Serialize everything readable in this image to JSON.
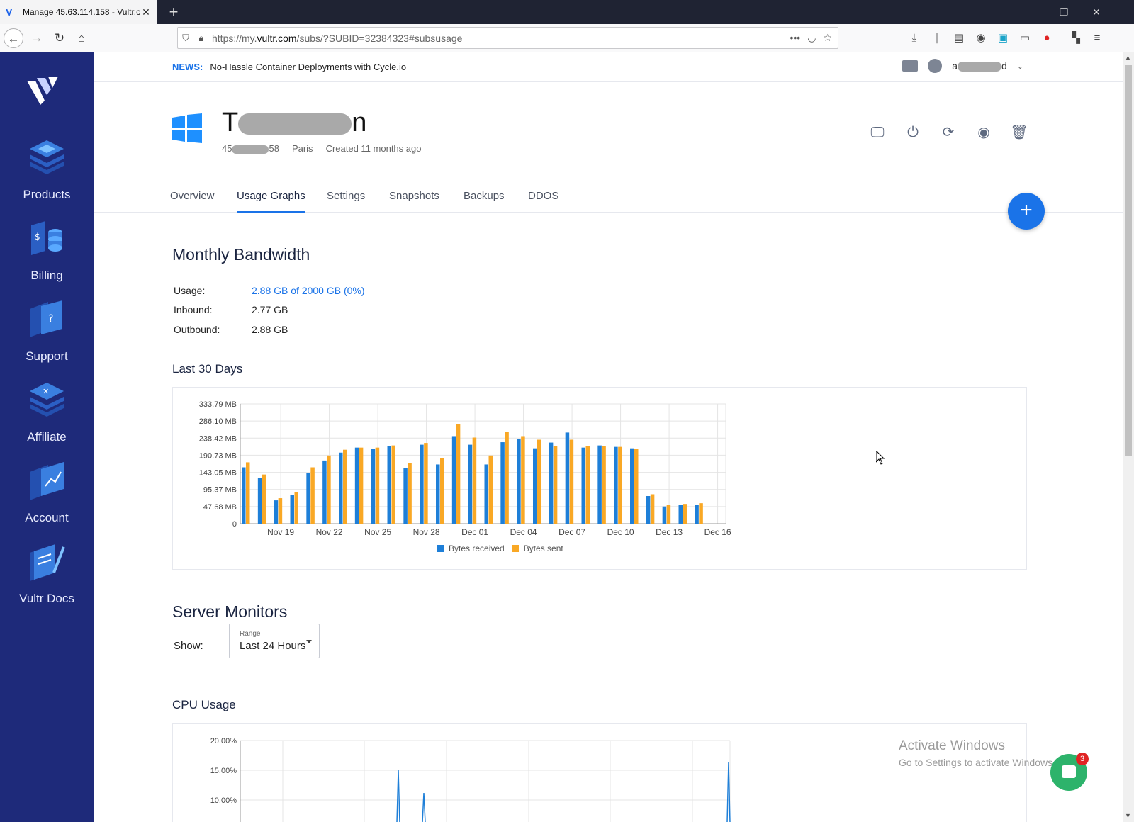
{
  "browser": {
    "tab_title": "Manage 45.63.114.158 - Vultr.com",
    "url_prefix": "https://my.",
    "url_domain": "vultr.com",
    "url_suffix": "/subs/?SUBID=32384323#subsusage"
  },
  "sidebar": {
    "items": [
      {
        "label": "Products",
        "icon": "products-icon"
      },
      {
        "label": "Billing",
        "icon": "billing-icon"
      },
      {
        "label": "Support",
        "icon": "support-icon"
      },
      {
        "label": "Affiliate",
        "icon": "affiliate-icon"
      },
      {
        "label": "Account",
        "icon": "account-icon"
      },
      {
        "label": "Vultr Docs",
        "icon": "docs-icon"
      }
    ]
  },
  "header": {
    "news_tag": "NEWS:",
    "news_text": "No-Hassle Container Deployments with Cycle.io",
    "user_prefix": "a",
    "user_suffix": "d"
  },
  "server": {
    "name_prefix": "T",
    "name_suffix": "n",
    "ip_prefix": "45",
    "ip_suffix": "58",
    "location": "Paris",
    "created": "Created 11 months ago"
  },
  "tabs": [
    {
      "label": "Overview",
      "active": false
    },
    {
      "label": "Usage Graphs",
      "active": true
    },
    {
      "label": "Settings",
      "active": false
    },
    {
      "label": "Snapshots",
      "active": false
    },
    {
      "label": "Backups",
      "active": false
    },
    {
      "label": "DDOS",
      "active": false
    }
  ],
  "bandwidth": {
    "title": "Monthly Bandwidth",
    "usage_label": "Usage:",
    "usage_value": "2.88 GB of 2000 GB (0%)",
    "inbound_label": "Inbound:",
    "inbound_value": "2.77 GB",
    "outbound_label": "Outbound:",
    "outbound_value": "2.88 GB",
    "chart_title": "Last 30 Days"
  },
  "monitors": {
    "title": "Server Monitors",
    "show_label": "Show:",
    "range_label": "Range",
    "range_value": "Last 24 Hours",
    "cpu_title": "CPU Usage"
  },
  "watermark": {
    "line1": "Activate Windows",
    "line2": "Go to Settings to activate Windows."
  },
  "chat_badge": "3",
  "colors": {
    "received": "#1e7fd8",
    "sent": "#f9a825",
    "sidebar": "#1e2a7a",
    "accent": "#1a73e8"
  },
  "chart_data": [
    {
      "type": "bar",
      "ytick_labels": [
        "0",
        "47.68 MB",
        "95.37 MB",
        "143.05 MB",
        "190.73 MB",
        "238.42 MB",
        "286.10 MB",
        "333.79 MB"
      ],
      "ylim": [
        0,
        333.79
      ],
      "xtick_labels": [
        "Nov 19",
        "Nov 22",
        "Nov 25",
        "Nov 28",
        "Dec 01",
        "Dec 04",
        "Dec 07",
        "Dec 10",
        "Dec 13",
        "Dec 16"
      ],
      "categories": [
        "Nov 17",
        "Nov 18",
        "Nov 19",
        "Nov 20",
        "Nov 21",
        "Nov 22",
        "Nov 23",
        "Nov 24",
        "Nov 25",
        "Nov 26",
        "Nov 27",
        "Nov 28",
        "Nov 29",
        "Nov 30",
        "Dec 01",
        "Dec 02",
        "Dec 03",
        "Dec 04",
        "Dec 05",
        "Dec 06",
        "Dec 07",
        "Dec 08",
        "Dec 09",
        "Dec 10",
        "Dec 11",
        "Dec 12",
        "Dec 13",
        "Dec 14",
        "Dec 15",
        "Dec 16"
      ],
      "series": [
        {
          "name": "Bytes received",
          "values": [
            157,
            128,
            65,
            80,
            142,
            176,
            198,
            212,
            208,
            216,
            155,
            220,
            165,
            244,
            220,
            165,
            227,
            236,
            210,
            226,
            254,
            212,
            218,
            214,
            210,
            77,
            48,
            52,
            52,
            0
          ]
        },
        {
          "name": "Bytes sent",
          "values": [
            171,
            137,
            71,
            87,
            157,
            190,
            206,
            212,
            212,
            218,
            168,
            225,
            182,
            278,
            240,
            190,
            256,
            244,
            234,
            216,
            234,
            216,
            216,
            214,
            208,
            82,
            52,
            55,
            57,
            0
          ]
        }
      ],
      "grid": true,
      "legend": "bottom"
    },
    {
      "type": "line",
      "ytick_labels": [
        "10.00%",
        "15.00%",
        "20.00%"
      ],
      "series": [
        {
          "values": [
            0
          ]
        }
      ],
      "grid": true
    }
  ]
}
